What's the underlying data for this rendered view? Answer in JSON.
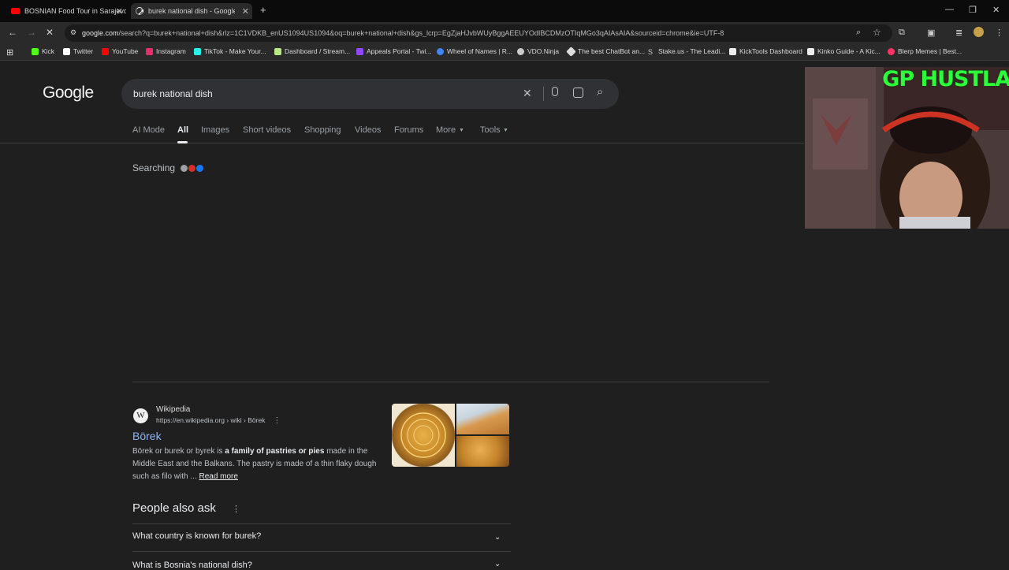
{
  "tabs": [
    {
      "title": "BOSNIAN Food Tour in Sarajevo",
      "favicon": "youtube-icon"
    },
    {
      "title": "burek national dish - Google Se",
      "favicon": "loading-icon"
    }
  ],
  "address_bar": {
    "host": "google.com",
    "path": "/search?q=burek+national+dish&rlz=1C1VDKB_enUS1094US1094&oq=burek+national+dish&gs_lcrp=EgZjaHJvbWUyBggAEEUYOdIBCDMzOTIqMGo3qAIAsAIA&sourceid=chrome&ie=UTF-8"
  },
  "bookmarks": [
    {
      "label": "Kick",
      "color": "#53fc18"
    },
    {
      "label": "Twitter",
      "color": "#ffffff"
    },
    {
      "label": "YouTube",
      "color": "#ff0000"
    },
    {
      "label": "Instagram",
      "color": "#e1306c"
    },
    {
      "label": "TikTok - Make Your...",
      "color": "#25f4ee"
    },
    {
      "label": "Dashboard / Stream...",
      "color": "#b8e986"
    },
    {
      "label": "Appeals Portal - Twi...",
      "color": "#9146ff"
    },
    {
      "label": "Wheel of Names | R...",
      "color": "#4285f4"
    },
    {
      "label": "VDO.Ninja",
      "color": "#cccccc"
    },
    {
      "label": "The best ChatBot an...",
      "color": "#dddddd"
    },
    {
      "label": "Stake.us - The Leadi...",
      "color": "#cccccc"
    },
    {
      "label": "KickTools Dashboard",
      "color": "#eeeeee"
    },
    {
      "label": "Kinko Guide - A Kic...",
      "color": "#eeeeee"
    },
    {
      "label": "Blerp Memes | Best...",
      "color": "#ff3366"
    }
  ],
  "google": {
    "logo": "Google",
    "query": "burek national dish",
    "tabs": [
      "AI Mode",
      "All",
      "Images",
      "Short videos",
      "Shopping",
      "Videos",
      "Forums",
      "More",
      "Tools"
    ],
    "searching_label": "Searching"
  },
  "result": {
    "site_name": "Wikipedia",
    "cite": "https://en.wikipedia.org › wiki › Börek",
    "title": "Börek",
    "snippet_pre": "Börek or burek or byrek is ",
    "snippet_bold": "a family of pastries or pies",
    "snippet_post": " made in the Middle East and the Balkans. The pastry is made of a thin flaky dough such as filo with ... ",
    "read_more": "Read more"
  },
  "people_also_ask": {
    "heading": "People also ask",
    "questions": [
      "What country is known for burek?",
      "What is Bosnia's national dish?"
    ]
  },
  "overlay": {
    "text": "GP HUSTLA"
  }
}
